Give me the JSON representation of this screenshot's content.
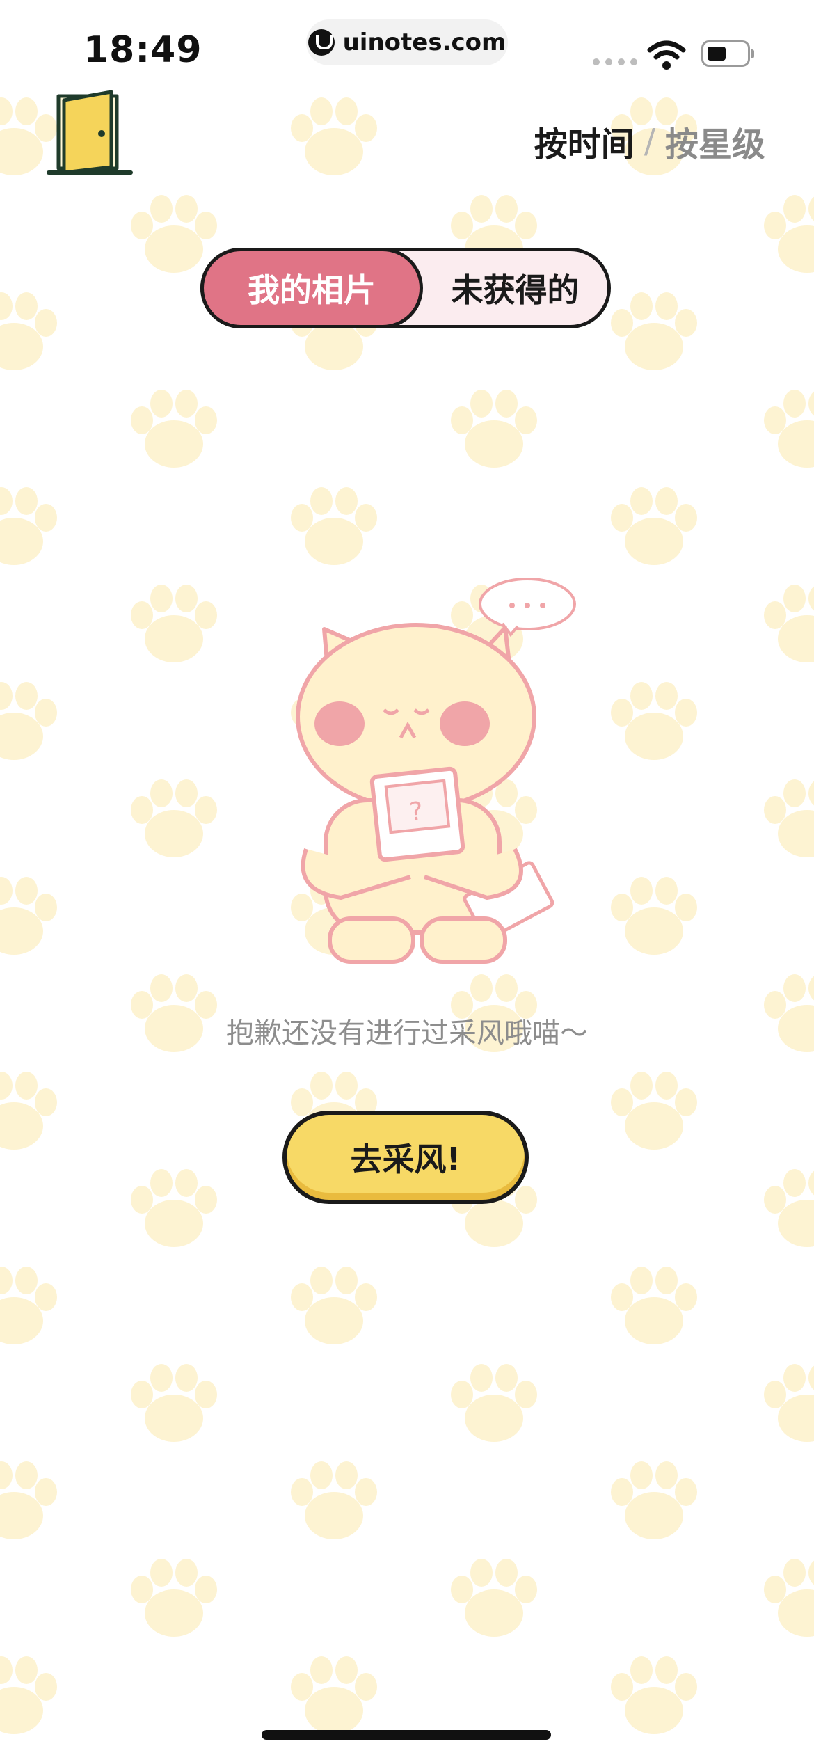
{
  "status_bar": {
    "time": "18:49",
    "url": "uinotes.com"
  },
  "header": {
    "sort_by_time": "按时间",
    "separator": "/",
    "sort_by_star": "按星级"
  },
  "tabs": {
    "my_photos": "我的相片",
    "not_obtained": "未获得的"
  },
  "empty_state": {
    "message": "抱歉还没有进行过采风哦喵～",
    "button_label": "去采风!"
  },
  "colors": {
    "accent_pink": "#e07486",
    "button_yellow": "#f7d966",
    "paw_pattern": "#fdf3d2"
  },
  "icons": {
    "exit": "door-icon",
    "empty_illustration": "cat-with-photo-illustration"
  }
}
